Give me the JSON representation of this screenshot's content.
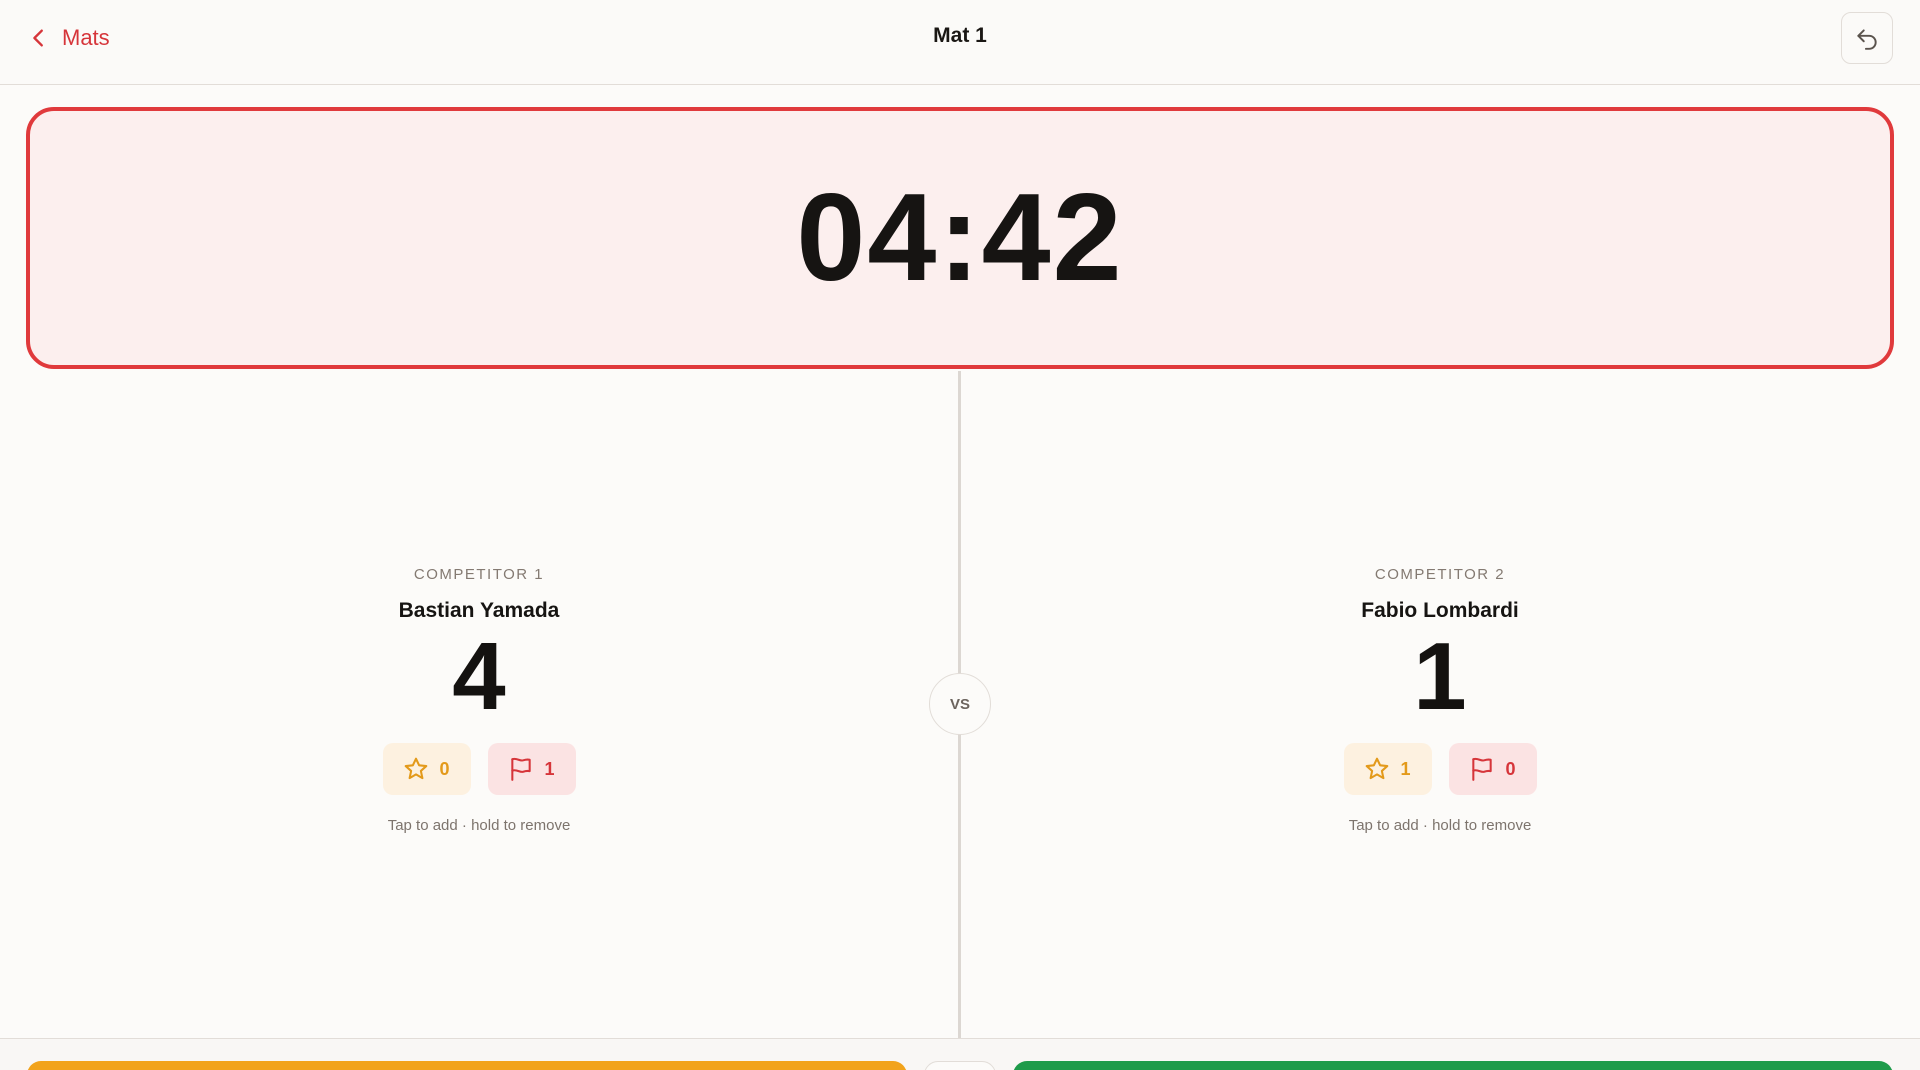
{
  "header": {
    "back_label": "Mats",
    "title": "Mat 1"
  },
  "timer": {
    "display": "04:42"
  },
  "vs_label": "VS",
  "competitors": [
    {
      "label": "COMPETITOR 1",
      "name": "Bastian Yamada",
      "score": "4",
      "advantages": "0",
      "penalties": "1",
      "hint": "Tap to add · hold to remove"
    },
    {
      "label": "COMPETITOR 2",
      "name": "Fabio Lombardi",
      "score": "1",
      "advantages": "1",
      "penalties": "0",
      "hint": "Tap to add · hold to remove"
    }
  ],
  "colors": {
    "accent_red": "#e03a3c",
    "advantage_orange": "#e39a1b",
    "bottom_orange": "#f2a31b",
    "bottom_green": "#1e9b4a"
  },
  "icons": {
    "back": "chevron-left-icon",
    "undo": "undo-icon",
    "advantage": "star-icon",
    "penalty": "flag-icon"
  }
}
